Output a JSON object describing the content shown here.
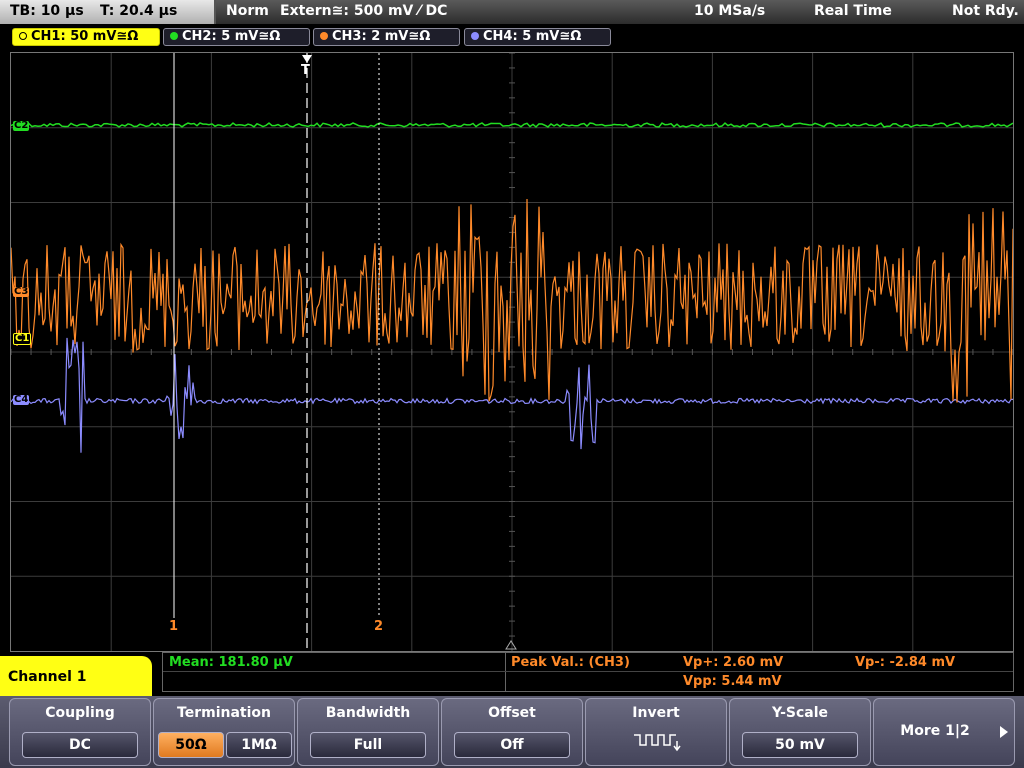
{
  "status_bar": {
    "timebase": "TB: 10 µs",
    "trigger_time": "T: 20.4 µs",
    "mode": "Norm",
    "trigger_source": "Extern≅: 500 mV ⁄ DC",
    "sample_rate": "10 MSa/s",
    "acquisition": "Real Time",
    "state": "Not Rdy."
  },
  "channels": [
    {
      "label": "CH1: 50 mV≅Ω",
      "color": "#ffff14",
      "active": true
    },
    {
      "label": "CH2: 5 mV≅Ω",
      "color": "#22dd22",
      "active": false
    },
    {
      "label": "CH3: 2 mV≅Ω",
      "color": "#ff8a2a",
      "active": false
    },
    {
      "label": "CH4: 5 mV≅Ω",
      "color": "#8c8cff",
      "active": false
    }
  ],
  "markers": {
    "ch1": "C1",
    "ch2": "C2",
    "ch3": "C3",
    "ch4": "C4",
    "trigger": "T",
    "cursor1": "1",
    "cursor2": "2"
  },
  "measurements": {
    "mean": "Mean: 181.80 µV",
    "peak_label": "Peak Val.: (CH3)",
    "vp_plus": "Vp+: 2.60 mV",
    "vp_minus": "Vp-: -2.84 mV",
    "vpp": "Vpp: 5.44 mV"
  },
  "menu": {
    "title": "Channel 1",
    "coupling": {
      "label": "Coupling",
      "value": "DC"
    },
    "termination": {
      "label": "Termination",
      "opt1": "50Ω",
      "opt2": "1MΩ"
    },
    "bandwidth": {
      "label": "Bandwidth",
      "value": "Full"
    },
    "offset": {
      "label": "Offset",
      "value": "Off"
    },
    "invert": {
      "label": "Invert"
    },
    "yscale": {
      "label": "Y-Scale",
      "value": "50 mV"
    },
    "more": {
      "label": "More 1|2"
    }
  },
  "colors": {
    "ch1": "#ffff14",
    "ch2": "#22dd22",
    "ch3": "#ff8a2a",
    "ch4": "#8c8cff",
    "highlight": "#e07a20"
  }
}
